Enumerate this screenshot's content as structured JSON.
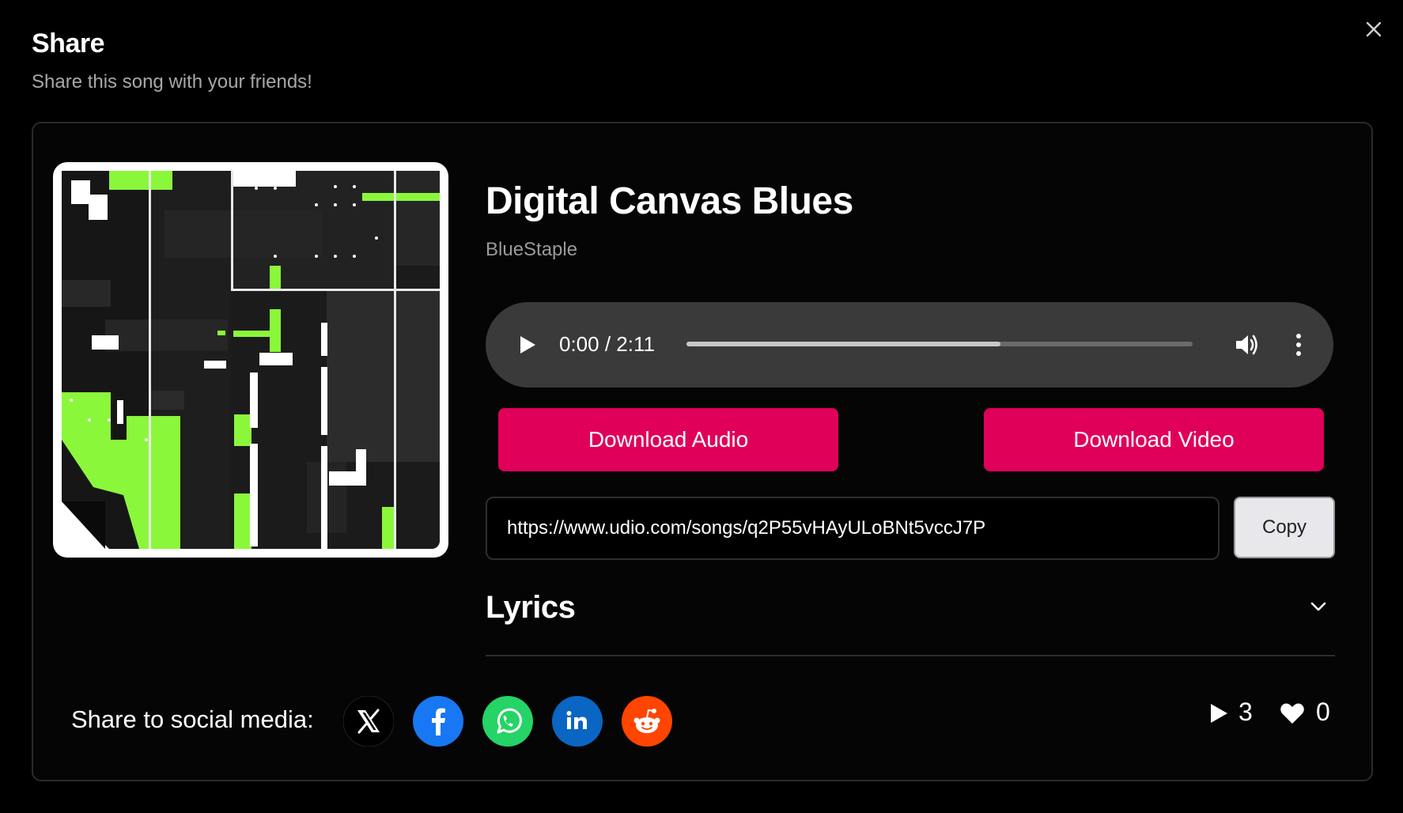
{
  "dialog": {
    "title": "Share",
    "subtitle": "Share this song with your friends!",
    "close_icon": "close-icon"
  },
  "song": {
    "title": "Digital Canvas Blues",
    "artist": "BlueStaple",
    "cover_art": "album-cover-art"
  },
  "player": {
    "time": "0:00 / 2:11",
    "progress_fraction": 0.62,
    "icons": [
      "play-icon",
      "volume-icon",
      "more-vertical-icon"
    ]
  },
  "actions": {
    "download_audio": "Download Audio",
    "download_video": "Download Video",
    "url": "https://www.udio.com/songs/q2P55vHAyULoBNt5vccJ7P",
    "copy": "Copy",
    "accent_color": "#e0005a"
  },
  "lyrics": {
    "title": "Lyrics",
    "icon": "chevron-down-icon"
  },
  "share": {
    "label": "Share to social media:",
    "networks": [
      {
        "name": "x-icon",
        "color": "#000000"
      },
      {
        "name": "facebook-icon",
        "color": "#1877f2"
      },
      {
        "name": "whatsapp-icon",
        "color": "#25d366"
      },
      {
        "name": "linkedin-icon",
        "color": "#0a66c2"
      },
      {
        "name": "reddit-icon",
        "color": "#ff4500"
      }
    ]
  },
  "stats": {
    "plays": "3",
    "likes": "0"
  }
}
